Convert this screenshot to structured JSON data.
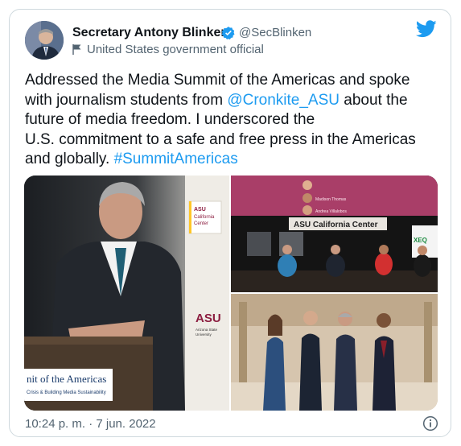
{
  "author": {
    "name": "Secretary Antony Blinken",
    "handle": "@SecBlinken",
    "label": "United States government official"
  },
  "tweet": {
    "line1": "Addressed the Media Summit of the Americas and spoke",
    "line2a": "with journalism students from ",
    "mention": "@Cronkite_ASU",
    "line2b": " about the",
    "line3": "future of media freedom. I underscored the",
    "line4": "U.S. commitment to a safe and free press in the Americas",
    "line5": "and globally. ",
    "hashtag": "#SummitAmericas"
  },
  "media": {
    "photo1_sign1": "ASU California Center",
    "photo1_logo": "ASU",
    "photo1_logo_sub": "Arizona State University",
    "photo1_podium": "nit of the Americas",
    "photo1_podium_sub": "Crisis & Building Media Sustainability",
    "photo2_banner": "ASU California Center",
    "photo2_side": "XEQ",
    "photo2_speakers": [
      "Madison Thomas",
      "Andrea Villalobos"
    ]
  },
  "timestamp": "10:24 p. m. · 7 jun. 2022",
  "colors": {
    "accent": "#1d9bf0",
    "muted": "#536471",
    "border": "#cfd9de"
  }
}
